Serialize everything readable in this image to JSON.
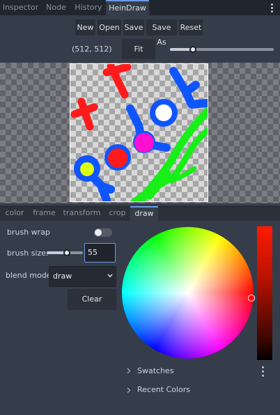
{
  "tabs": [
    {
      "label": "Inspector"
    },
    {
      "label": "Node"
    },
    {
      "label": "History"
    },
    {
      "label": "HeinDraw",
      "active": true
    }
  ],
  "toolbar": {
    "new_label": "New",
    "open_label": "Open",
    "save_label": "Save",
    "save_as_label": "Save As",
    "reset_label": "Reset",
    "size_readout": "(512, 512)",
    "fit_label": "Fit",
    "zoom_level": 0.22
  },
  "canvas": {
    "background": "transparent-checker",
    "colors": {
      "red": "#ff1b1b",
      "blue": "#0f55ff",
      "green": "#16f016",
      "magenta": "#ff10d0",
      "yellow": "#ddff10",
      "white": "#ffffff"
    }
  },
  "subtabs": [
    {
      "label": "color"
    },
    {
      "label": "frame"
    },
    {
      "label": "transform"
    },
    {
      "label": "crop"
    },
    {
      "label": "draw",
      "active": true
    }
  ],
  "draw_panel": {
    "brush_wrap_label": "brush wrap",
    "brush_wrap_on": false,
    "brush_size_label": "brush size:",
    "brush_size_value": "55",
    "brush_size_level": 0.55,
    "blend_mode_label": "blend mode",
    "blend_mode_value": "draw",
    "clear_label": "Clear"
  },
  "color_picker": {
    "current_color": "#ff0000",
    "swatches_label": "Swatches",
    "recent_colors_label": "Recent Colors"
  },
  "icons": {
    "kebab": "kebab-menu-icon",
    "dropdown": "chevron-down-icon",
    "expand": "chevron-right-icon"
  }
}
